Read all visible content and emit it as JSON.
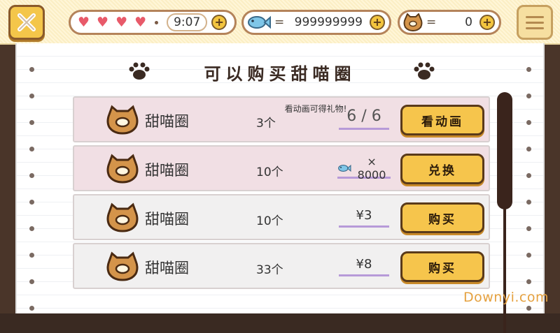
{
  "topbar": {
    "hearts": [
      "♥",
      "♥",
      "♥",
      "♥"
    ],
    "timer": "9:07",
    "fish_eq": "=",
    "fish_amount": "999999999",
    "donut_eq": "=",
    "donut_amount": "0",
    "plus": "+"
  },
  "panel": {
    "title": "可以购买甜喵圈"
  },
  "rows": [
    {
      "name": "甜喵圈",
      "qty": "3个",
      "note": "看动画可得礼物!",
      "value": "6 / 6",
      "button": "看动画"
    },
    {
      "name": "甜喵圈",
      "qty": "10个",
      "value": "× 8000",
      "button": "兑换"
    },
    {
      "name": "甜喵圈",
      "qty": "10个",
      "value": "¥3",
      "button": "购买"
    },
    {
      "name": "甜喵圈",
      "qty": "33个",
      "value": "¥8",
      "button": "购买"
    }
  ],
  "watermark": "Downyi.com",
  "colors": {
    "accent": "#f6c54c",
    "heart": "#e85a6a",
    "underline": "#b79ad8"
  }
}
